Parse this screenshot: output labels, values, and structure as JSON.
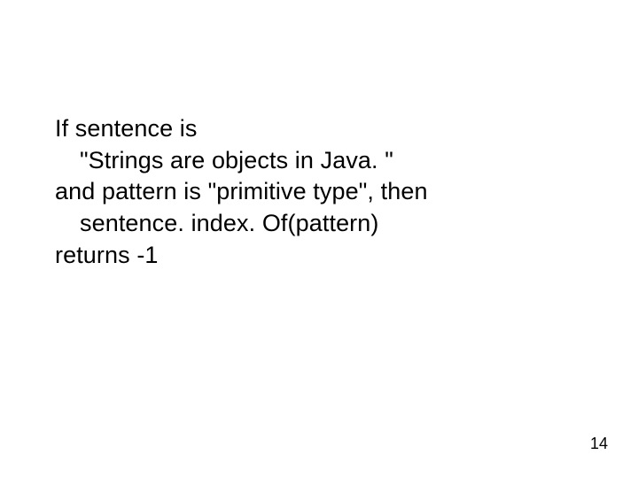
{
  "slide": {
    "lines": [
      {
        "text": "If sentence is",
        "indent": false
      },
      {
        "text": "\"Strings are objects in Java. \"",
        "indent": true
      },
      {
        "text": "and pattern is \"primitive type\", then",
        "indent": false
      },
      {
        "text": "sentence. index. Of(pattern)",
        "indent": true
      },
      {
        "text": "returns -1",
        "indent": false
      }
    ],
    "page_number": "14"
  }
}
